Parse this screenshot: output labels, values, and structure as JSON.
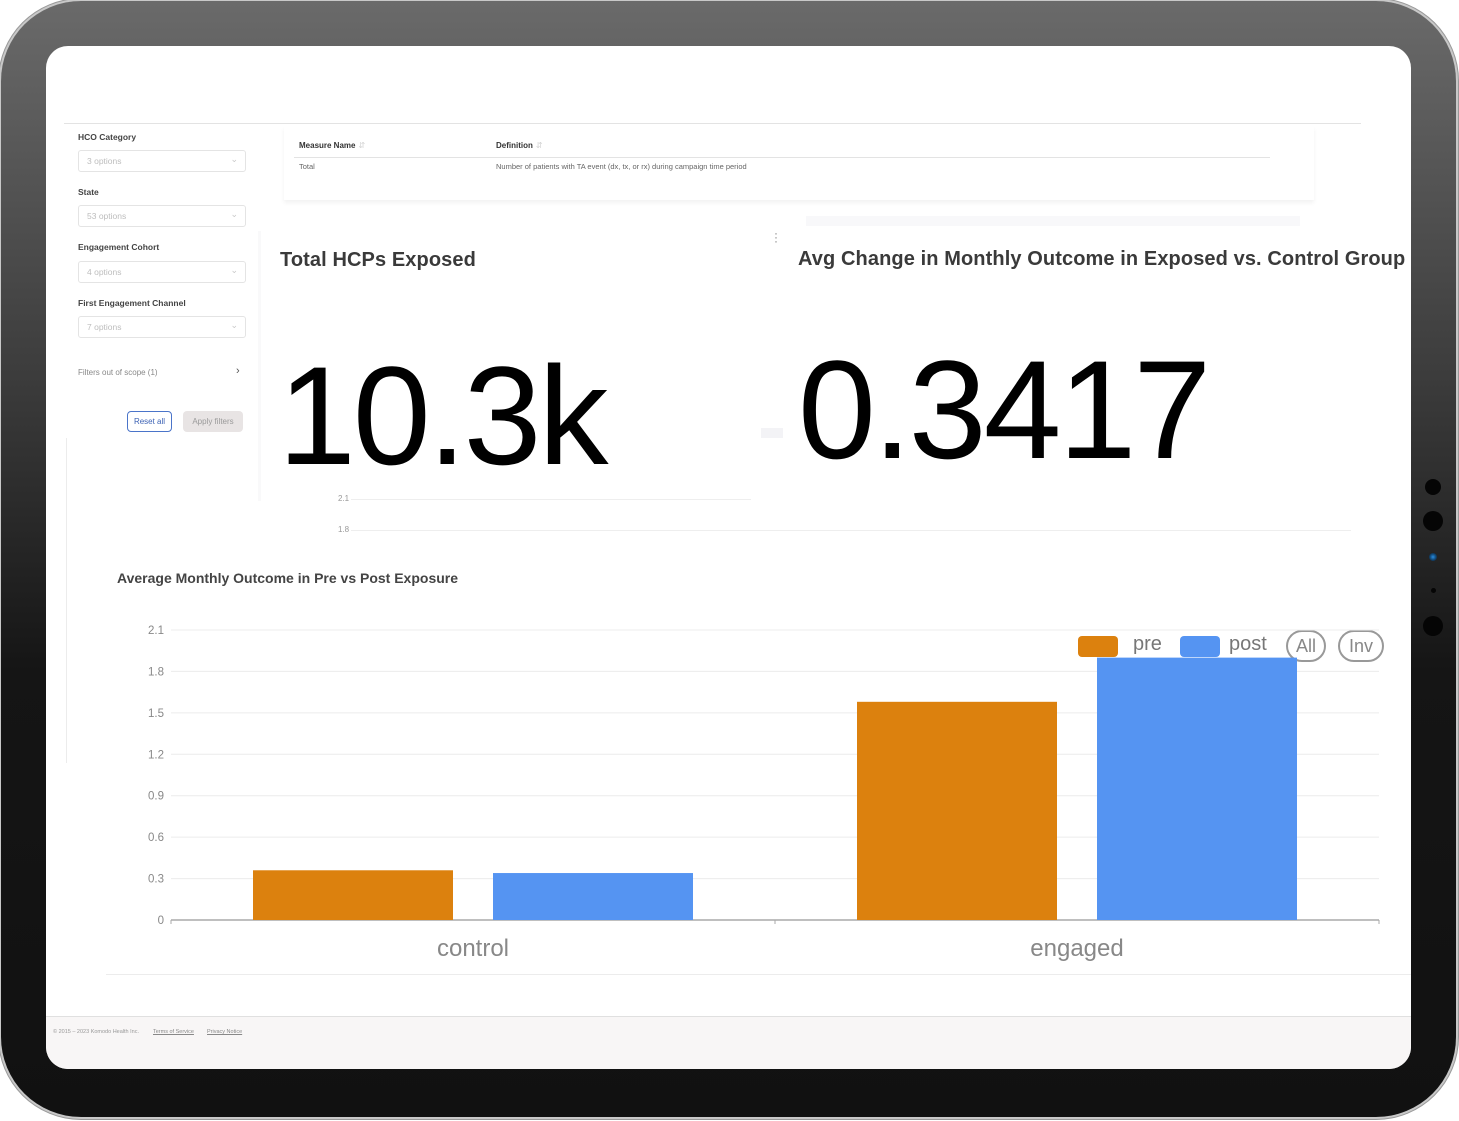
{
  "filters": {
    "fields": [
      {
        "label": "HCO Category",
        "placeholder": "3 options"
      },
      {
        "label": "State",
        "placeholder": "53 options"
      },
      {
        "label": "Engagement Cohort",
        "placeholder": "4 options"
      },
      {
        "label": "First Engagement Channel",
        "placeholder": "7 options"
      }
    ],
    "out_of_scope": "Filters out of scope (1)",
    "reset_label": "Reset all",
    "apply_label": "Apply filters",
    "chevron_icon": "chevron-down-icon"
  },
  "definitions": {
    "columns": [
      "Measure Name",
      "Definition"
    ],
    "rows": [
      {
        "measure": "Total",
        "definition": "Number of patients with TA event (dx, tx, or rx) during campaign time period"
      }
    ]
  },
  "kpis": [
    {
      "title": "Total HCPs Exposed",
      "value": "10.3k"
    },
    {
      "title": "Avg Change in Monthly Outcome in Exposed vs. Control Group",
      "value": "0.3417"
    }
  ],
  "ghost_chart": {
    "ticks": [
      "2.1",
      "1.8"
    ]
  },
  "chart_data": {
    "type": "bar",
    "title": "Average Monthly Outcome in Pre vs Post Exposure",
    "categories": [
      "control",
      "engaged"
    ],
    "series": [
      {
        "name": "pre",
        "color": "#dc810e",
        "values": [
          0.36,
          1.58
        ]
      },
      {
        "name": "post",
        "color": "#5594f2",
        "values": [
          0.34,
          1.9
        ]
      }
    ],
    "xlabel": "",
    "ylabel": "",
    "ylim": [
      0,
      2.1
    ],
    "yticks": [
      "0",
      "0.3",
      "0.6",
      "0.9",
      "1.2",
      "1.5",
      "1.8",
      "2.1"
    ],
    "grid": true,
    "legend": "top-right",
    "legend_buttons": [
      "All",
      "Inv"
    ]
  },
  "footer": {
    "copyright": "© 2015 – 2023 Komodo Health Inc.",
    "terms": "Terms of Service",
    "privacy": "Privacy Notice"
  }
}
